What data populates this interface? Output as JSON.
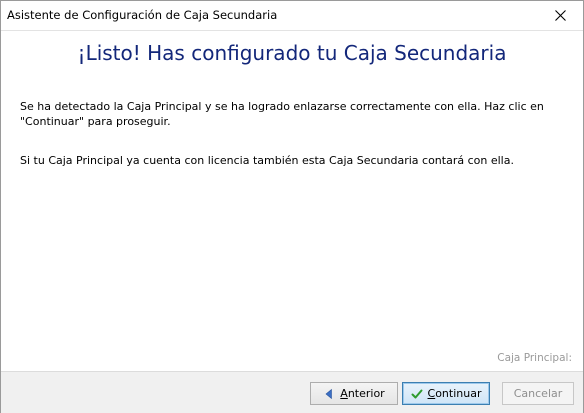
{
  "window": {
    "title": "Asistente de Configuración de Caja Secundaria"
  },
  "content": {
    "heading": "¡Listo! Has configurado tu Caja Secundaria",
    "paragraph1": "Se ha detectado la Caja Principal y se ha logrado enlazarse correctamente con ella. Haz clic en \"Continuar\" para proseguir.",
    "paragraph2": "Si tu Caja Principal ya cuenta con licencia también esta Caja Secundaria contará con ella.",
    "status_label": "Caja Principal:"
  },
  "buttons": {
    "previous": {
      "label_first": "A",
      "label_rest": "nterior",
      "icon": "arrow-left-icon"
    },
    "continue": {
      "label_first": "C",
      "label_rest": "ontinuar",
      "icon": "check-icon"
    },
    "cancel": {
      "label": "Cancelar",
      "enabled": false
    }
  },
  "colors": {
    "heading": "#13277a",
    "footer_bg": "#f0f0f0",
    "check_green": "#2e9b2e",
    "arrow_blue": "#3b6fc4"
  }
}
